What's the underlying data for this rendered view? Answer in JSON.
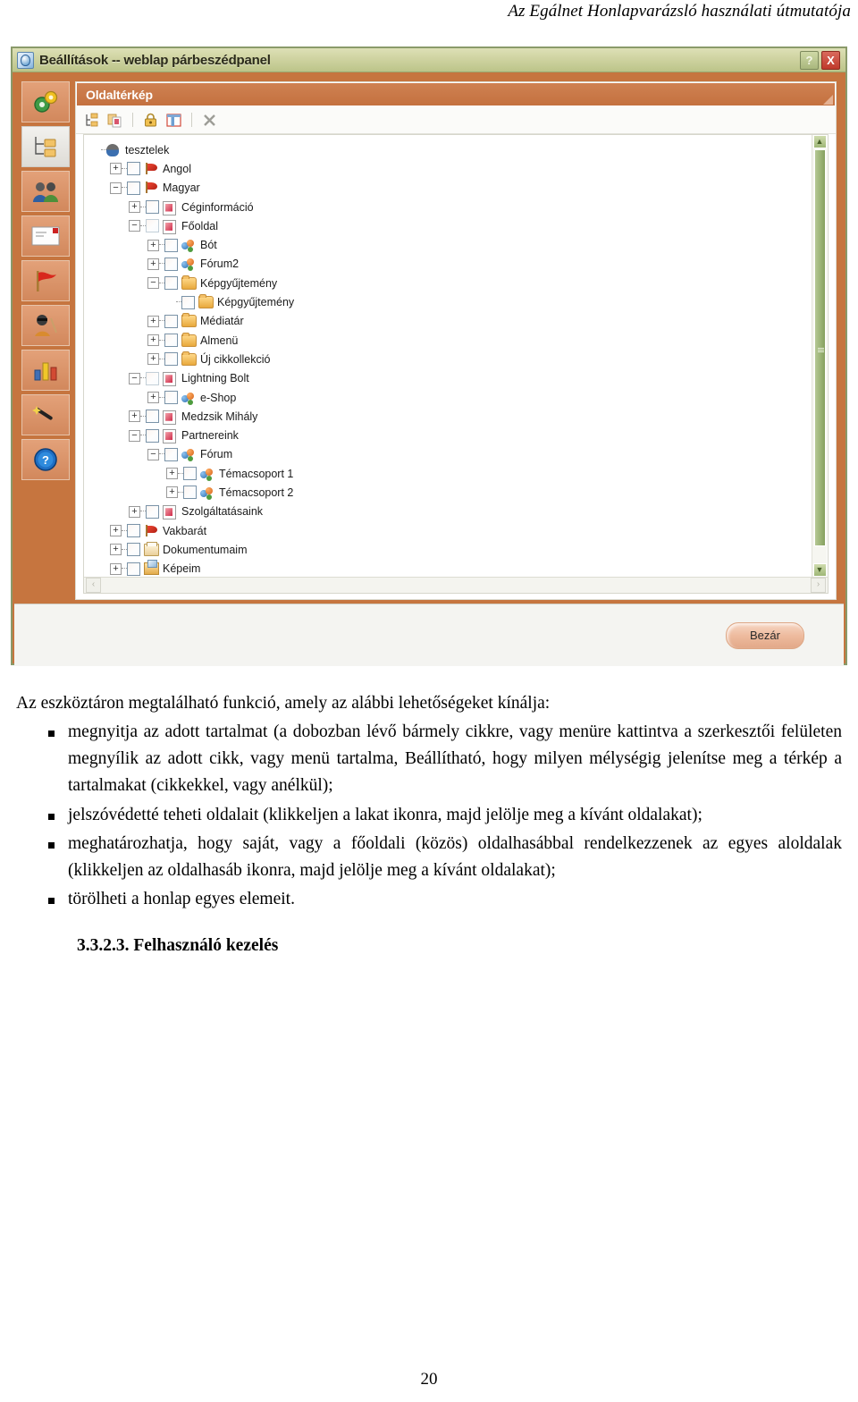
{
  "document": {
    "running_header": "Az Egálnet Honlapvarázsló használati útmutatója",
    "page_number": "20",
    "intro": "Az eszköztáron megtalálható funkció, amely az alábbi lehetőségeket kínálja:",
    "bullets": [
      "megnyitja az adott tartalmat (a dobozban lévő bármely cikkre, vagy menüre kattintva a szerkesztői felületen megnyílik az adott cikk, vagy menü tartalma, Beállítható, hogy milyen mélységig jelenítse meg a térkép a tartalmakat (cikkekkel, vagy anélkül);",
      "jelszóvédetté teheti oldalait (klikkeljen a lakat ikonra, majd jelölje meg a kívánt oldalakat);",
      "meghatározhatja, hogy saját, vagy a főoldali (közös) oldalhasábbal rendelkezzenek az egyes aloldalak (klikkeljen az oldalhasáb ikonra, majd jelölje meg a kívánt oldalakat);",
      "törölheti a honlap egyes elemeit."
    ],
    "heading": "3.3.2.3. Felhasználó kezelés"
  },
  "dialog": {
    "title": "Beállítások -- weblap párbeszédpanel",
    "title_icon": "internet-explorer-icon",
    "help_label": "?",
    "close_label": "X",
    "footer": {
      "close_button": "Bezár"
    },
    "sidebar": {
      "items": [
        {
          "name": "settings-gears",
          "icon": "gears-icon"
        },
        {
          "name": "sitemap",
          "icon": "sitemap-tree-icon"
        },
        {
          "name": "users",
          "icon": "users-icon"
        },
        {
          "name": "mail",
          "icon": "envelope-icon"
        },
        {
          "name": "language",
          "icon": "red-flag-icon"
        },
        {
          "name": "accessibility",
          "icon": "blind-person-icon"
        },
        {
          "name": "statistics",
          "icon": "bar-chart-icon"
        },
        {
          "name": "wizard",
          "icon": "magic-wand-icon"
        },
        {
          "name": "help",
          "icon": "question-mark-icon"
        }
      ]
    },
    "panel": {
      "header": "Oldaltérkép",
      "toolbar": [
        {
          "name": "expand-tree-button",
          "icon": "tree-structure-icon"
        },
        {
          "name": "copy-page-button",
          "icon": "copy-pages-icon"
        },
        {
          "name": "separator-1",
          "icon": "separator"
        },
        {
          "name": "password-protect-button",
          "icon": "lock-icon"
        },
        {
          "name": "sidebar-column-button",
          "icon": "columns-layout-icon"
        },
        {
          "name": "separator-2",
          "icon": "separator"
        },
        {
          "name": "delete-button",
          "icon": "x-delete-icon"
        }
      ],
      "scrollbar": {
        "up": "▲",
        "down": "▼",
        "left": "‹",
        "right": "›"
      },
      "tree": [
        {
          "label": "tesztelek",
          "depth": 0,
          "expander": "none",
          "checkbox": false,
          "icon": "user-icon"
        },
        {
          "label": "Angol",
          "depth": 1,
          "expander": "plus",
          "checkbox": true,
          "icon": "flag-icon"
        },
        {
          "label": "Magyar",
          "depth": 1,
          "expander": "minus",
          "checkbox": true,
          "icon": "flag-icon"
        },
        {
          "label": "Céginformáció",
          "depth": 2,
          "expander": "plus",
          "checkbox": true,
          "icon": "page-icon"
        },
        {
          "label": "Főoldal",
          "depth": 2,
          "expander": "minus",
          "checkbox": true,
          "icon": "page-icon",
          "checkbox_pale": true
        },
        {
          "label": "Bót",
          "depth": 3,
          "expander": "plus",
          "checkbox": true,
          "icon": "balls-icon"
        },
        {
          "label": "Fórum2",
          "depth": 3,
          "expander": "plus",
          "checkbox": true,
          "icon": "balls-icon"
        },
        {
          "label": "Képgyűjtemény",
          "depth": 3,
          "expander": "minus",
          "checkbox": true,
          "icon": "folder-icon"
        },
        {
          "label": "Képgyűjtemény",
          "depth": 4,
          "expander": "none",
          "checkbox": true,
          "icon": "folder-icon"
        },
        {
          "label": "Médiatár",
          "depth": 3,
          "expander": "plus",
          "checkbox": true,
          "icon": "folder-icon"
        },
        {
          "label": "Almenü",
          "depth": 3,
          "expander": "plus",
          "checkbox": true,
          "icon": "folder-icon"
        },
        {
          "label": "Új cikkollekció",
          "depth": 3,
          "expander": "plus",
          "checkbox": true,
          "icon": "folder-icon"
        },
        {
          "label": "Lightning Bolt",
          "depth": 2,
          "expander": "minus",
          "checkbox": true,
          "icon": "page-icon",
          "checkbox_pale": true
        },
        {
          "label": "e-Shop",
          "depth": 3,
          "expander": "plus",
          "checkbox": true,
          "icon": "balls-icon"
        },
        {
          "label": "Medzsik Mihály",
          "depth": 2,
          "expander": "plus",
          "checkbox": true,
          "icon": "page-icon"
        },
        {
          "label": "Partnereink",
          "depth": 2,
          "expander": "minus",
          "checkbox": true,
          "icon": "page-icon"
        },
        {
          "label": "Fórum",
          "depth": 3,
          "expander": "minus",
          "checkbox": true,
          "icon": "balls-icon"
        },
        {
          "label": "Témacsoport 1",
          "depth": 4,
          "expander": "plus",
          "checkbox": true,
          "icon": "balls-icon"
        },
        {
          "label": "Témacsoport 2",
          "depth": 4,
          "expander": "plus",
          "checkbox": true,
          "icon": "balls-icon"
        },
        {
          "label": "Szolgáltatásaink",
          "depth": 2,
          "expander": "plus",
          "checkbox": true,
          "icon": "page-icon"
        },
        {
          "label": "Vakbarát",
          "depth": 1,
          "expander": "plus",
          "checkbox": true,
          "icon": "flag-icon"
        },
        {
          "label": "Dokumentumaim",
          "depth": 1,
          "expander": "plus",
          "checkbox": true,
          "icon": "docs-icon"
        },
        {
          "label": "Képeim",
          "depth": 1,
          "expander": "plus",
          "checkbox": true,
          "icon": "pics-icon"
        }
      ]
    }
  },
  "colors": {
    "dialog_body": "#c6753f",
    "titlebar": "#cfd3a1",
    "panel_header": "#c4713f",
    "scrollbar": "#9cb477",
    "close_button": "#eebb9e"
  }
}
